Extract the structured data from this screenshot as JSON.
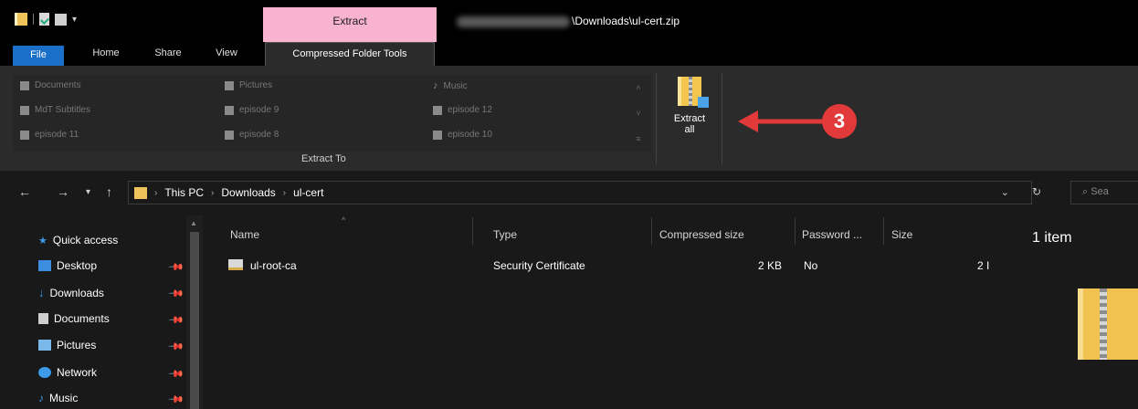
{
  "title_bar": {
    "context_tab": "Extract",
    "path_suffix": "\\Downloads\\ul-cert.zip"
  },
  "tabs": [
    {
      "label": "File"
    },
    {
      "label": "Home"
    },
    {
      "label": "Share"
    },
    {
      "label": "View"
    },
    {
      "label": "Compressed Folder Tools"
    }
  ],
  "ribbon": {
    "extract_to_items": [
      {
        "label": "Documents"
      },
      {
        "label": "MdT Subtitles"
      },
      {
        "label": "episode 11"
      },
      {
        "label": "Pictures"
      },
      {
        "label": "episode 9"
      },
      {
        "label": "episode 8"
      },
      {
        "label": "Music"
      },
      {
        "label": "episode 12"
      },
      {
        "label": "episode 10"
      }
    ],
    "extract_to_label": "Extract To",
    "extract_all_label": "Extract\nall"
  },
  "annotation": {
    "number": "3",
    "color": "#e23a3a"
  },
  "address": {
    "crumbs": [
      "This PC",
      "Downloads",
      "ul-cert"
    ],
    "search_placeholder": "Sea"
  },
  "nav_pane": {
    "items": [
      {
        "label": "Quick access",
        "icon": "star-icon",
        "color": "#3d9be9"
      },
      {
        "label": "Desktop",
        "icon": "desktop-icon",
        "color": "#3d8de0"
      },
      {
        "label": "Downloads",
        "icon": "download-arrow-icon",
        "color": "#3d9be9"
      },
      {
        "label": "Documents",
        "icon": "document-icon",
        "color": "#cfcfcf"
      },
      {
        "label": "Pictures",
        "icon": "pictures-icon",
        "color": "#7ab8ea"
      },
      {
        "label": "Network",
        "icon": "network-icon",
        "color": "#3d9be9"
      },
      {
        "label": "Music",
        "icon": "music-icon",
        "color": "#3d9be9"
      }
    ]
  },
  "columns": [
    "Name",
    "Type",
    "Compressed size",
    "Password ...",
    "Size"
  ],
  "files": [
    {
      "name": "ul-root-ca",
      "type": "Security Certificate",
      "compressed_size": "2 KB",
      "password": "No",
      "size": "2 I"
    }
  ],
  "details": {
    "count": "1 item"
  }
}
